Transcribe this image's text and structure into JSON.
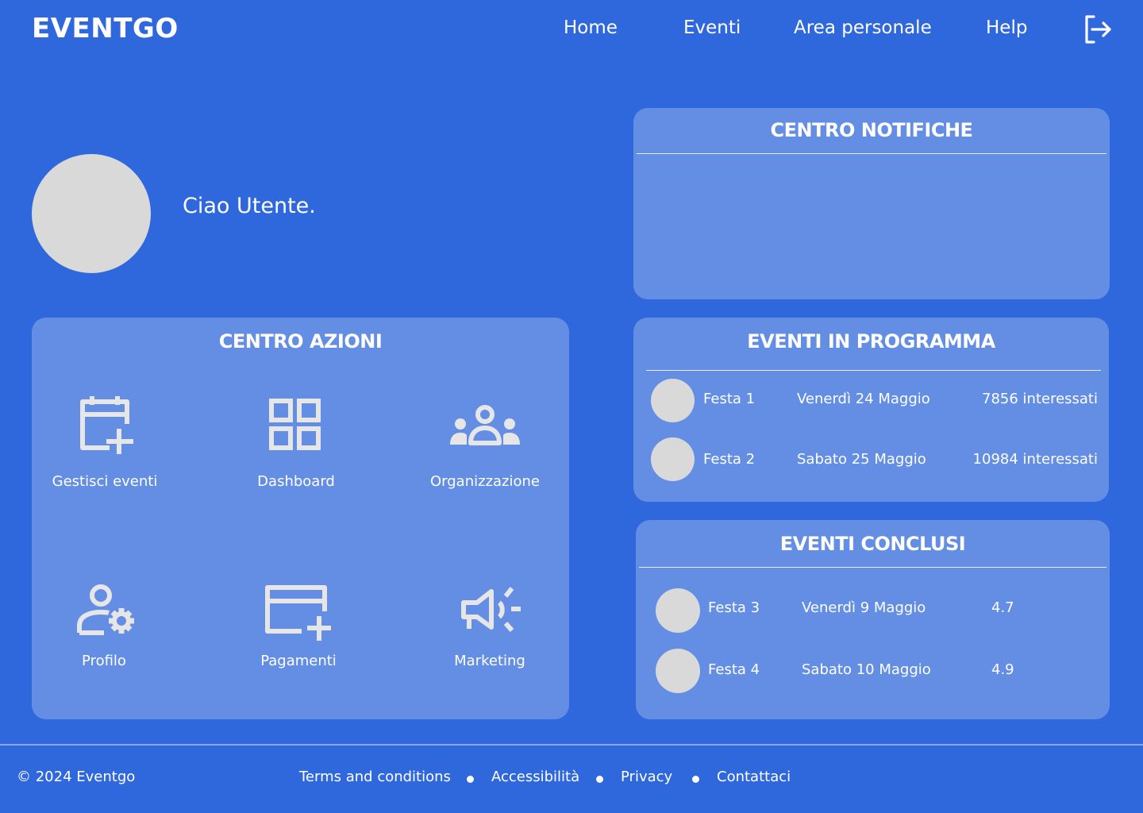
{
  "header": {
    "logo": "EVENTGO",
    "nav": [
      "Home",
      "Eventi",
      "Area personale",
      "Help"
    ],
    "logout_icon": "logout-icon"
  },
  "greeting": "Ciao Utente.",
  "notifications": {
    "title": "CENTRO NOTIFICHE"
  },
  "actions": {
    "title": "CENTRO AZIONI",
    "items": [
      {
        "label": "Gestisci eventi",
        "icon": "calendar-add-icon"
      },
      {
        "label": "Dashboard",
        "icon": "dashboard-icon"
      },
      {
        "label": "Organizzazione",
        "icon": "group-icon"
      },
      {
        "label": "Profilo",
        "icon": "user-settings-icon"
      },
      {
        "label": "Pagamenti",
        "icon": "card-add-icon"
      },
      {
        "label": "Marketing",
        "icon": "megaphone-icon"
      }
    ]
  },
  "upcoming": {
    "title": "EVENTI IN PROGRAMMA",
    "rows": [
      {
        "name": "Festa 1",
        "date": "Venerdì 24 Maggio",
        "info": "7856 interessati"
      },
      {
        "name": "Festa 2",
        "date": "Sabato 25 Maggio",
        "info": "10984 interessati"
      }
    ]
  },
  "past": {
    "title": "EVENTI CONCLUSI",
    "rows": [
      {
        "name": "Festa 3",
        "date": "Venerdì 9 Maggio",
        "info": "4.7"
      },
      {
        "name": "Festa 4",
        "date": "Sabato 10 Maggio",
        "info": "4.9"
      }
    ]
  },
  "footer": {
    "copyright": "© 2024 Eventgo",
    "links": [
      "Terms and conditions",
      "Accessibilità",
      "Privacy",
      "Contattaci"
    ]
  },
  "colors": {
    "background": "#2f68dc",
    "panel": "#638ee4",
    "avatar": "#d9d9d9",
    "icon": "#e6e6e6"
  }
}
